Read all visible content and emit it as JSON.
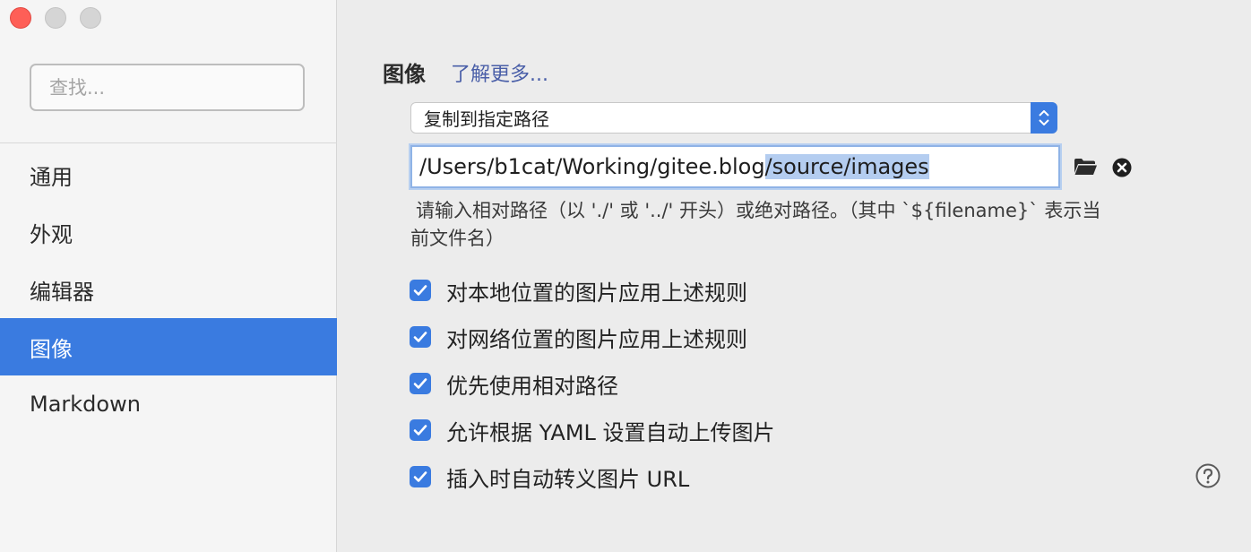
{
  "window": {
    "traffic_lights": [
      "close",
      "minimize",
      "maximize"
    ]
  },
  "sidebar": {
    "search_placeholder": "查找...",
    "items": [
      {
        "label": "通用",
        "active": false
      },
      {
        "label": "外观",
        "active": false
      },
      {
        "label": "编辑器",
        "active": false
      },
      {
        "label": "图像",
        "active": true
      },
      {
        "label": "Markdown",
        "active": false
      }
    ]
  },
  "main": {
    "section_title": "图像",
    "learn_more": "了解更多...",
    "select_value": "复制到指定路径",
    "path_value_plain": "/Users/b1cat/Working/gitee.blog",
    "path_value_selected": "/source/images",
    "hint_line1": "请输入相对路径（以 './' 或 '../' 开头）或绝对路径。（其中 `${filename}` 表示当",
    "hint_line2": "前文件名）",
    "checkboxes": [
      {
        "label": "对本地位置的图片应用上述规则",
        "checked": true
      },
      {
        "label": "对网络位置的图片应用上述规则",
        "checked": true
      },
      {
        "label": "优先使用相对路径",
        "checked": true
      },
      {
        "label": "允许根据 YAML 设置自动上传图片",
        "checked": true
      },
      {
        "label": "插入时自动转义图片 URL",
        "checked": true
      }
    ],
    "icons": [
      "folder-icon",
      "clear-icon",
      "help-icon",
      "checkmark-icon",
      "stepper-icon"
    ]
  },
  "colors": {
    "accent": "#3a7be0",
    "link": "#4a5fa8",
    "selection": "#b4cdf0",
    "close_light": "#fe5f57"
  }
}
